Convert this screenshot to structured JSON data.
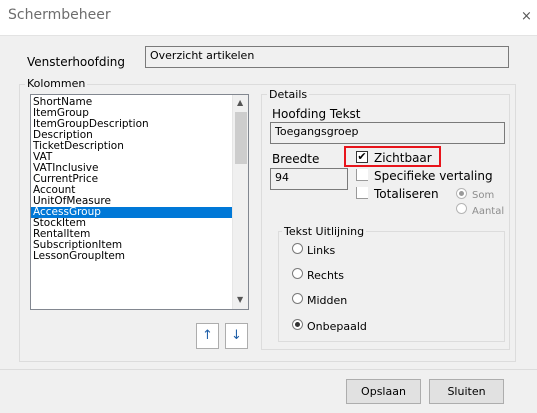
{
  "window": {
    "title": "Schermbeheer",
    "close_glyph": "×"
  },
  "header": {
    "label": "Vensterhoofding",
    "value": "Overzicht artikelen"
  },
  "columns": {
    "group_title": "Kolommen",
    "items": [
      "ShortName",
      "ItemGroup",
      "ItemGroupDescription",
      "Description",
      "TicketDescription",
      "VAT",
      "VATInclusive",
      "CurrentPrice",
      "Account",
      "UnitOfMeasure",
      "AccessGroup",
      "StockItem",
      "RentalItem",
      "SubscriptionItem",
      "LessonGroupItem"
    ],
    "selected_index": 10,
    "up_glyph": "↑",
    "down_glyph": "↓"
  },
  "details": {
    "group_title": "Details",
    "heading_label": "Hoofding Tekst",
    "heading_value": "Toegangsgroep",
    "width_label": "Breedte",
    "width_value": "94",
    "visible_label": "Zichtbaar",
    "visible_checked": true,
    "check_glyph": "✔",
    "translation_label": "Specifieke vertaling",
    "totals_label": "Totaliseren",
    "sum_label": "Som",
    "count_label": "Aantal",
    "align_group_title": "Tekst Uitlijning",
    "align_left": "Links",
    "align_right": "Rechts",
    "align_center": "Midden",
    "align_undefined": "Onbepaald",
    "align_selected": "Onbepaald",
    "highlight_color": "#e8141b"
  },
  "footer": {
    "save_label": "Opslaan",
    "close_label": "Sluiten"
  }
}
